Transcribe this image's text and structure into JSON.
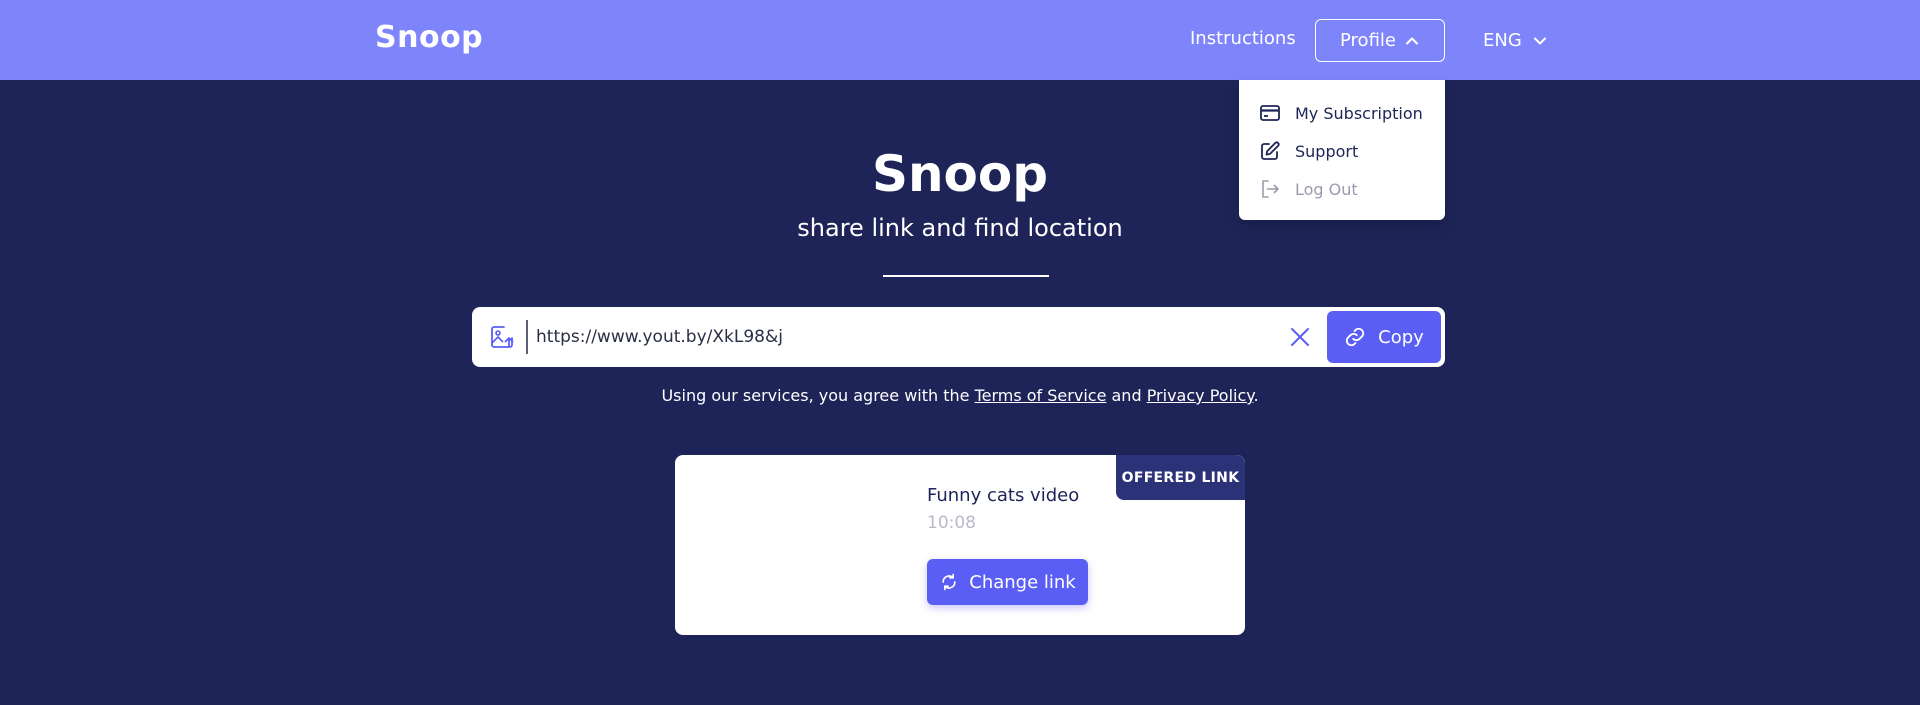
{
  "colors": {
    "header_bg": "#7e85fb",
    "page_bg": "#1e2458",
    "accent": "#5b5ef5",
    "badge_bg": "#2c3278"
  },
  "header": {
    "logo": "Snoop",
    "instructions_label": "Instructions",
    "profile_label": "Profile",
    "language_label": "ENG"
  },
  "profile_menu": {
    "items": [
      {
        "label": "My Subscription",
        "icon": "credit-card-icon"
      },
      {
        "label": "Support",
        "icon": "edit-icon"
      },
      {
        "label": "Log Out",
        "icon": "logout-icon"
      }
    ]
  },
  "hero": {
    "title": "Snoop",
    "subtitle": "share link and find location"
  },
  "url_bar": {
    "value": "https://www.yout.by/XkL98&j",
    "copy_label": "Copy",
    "upload_icon": "image-upload-icon",
    "clear_icon": "close-icon"
  },
  "terms": {
    "prefix": "Using our services, you agree with the ",
    "tos_label": "Terms of Service",
    "and": " and ",
    "privacy_label": "Privacy Policy",
    "suffix": "."
  },
  "card": {
    "badge": "OFFERED LINK",
    "title": "Funny cats video",
    "time": "10:08",
    "change_label": "Change link"
  }
}
